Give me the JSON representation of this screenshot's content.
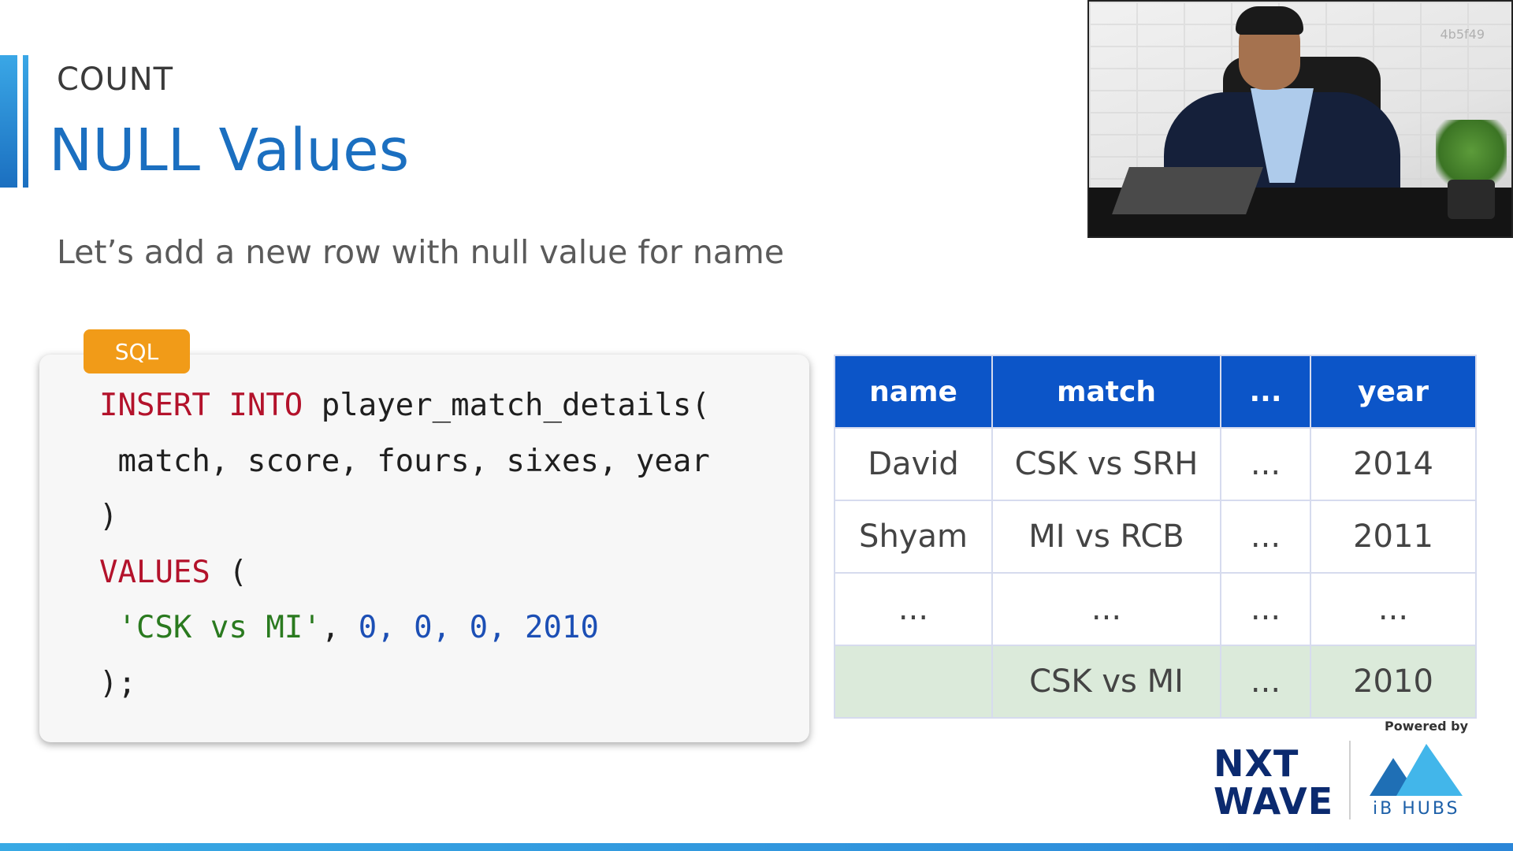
{
  "slide": {
    "topic": "COUNT",
    "title": "NULL Values",
    "subtitle": "Let’s add a new row with null value for name"
  },
  "code_card": {
    "language": "SQL",
    "lines": [
      {
        "parts": [
          {
            "t": "INSERT INTO",
            "c": "kw"
          },
          {
            "t": " player_match_details(",
            "c": ""
          }
        ]
      },
      {
        "parts": [
          {
            "t": " match, score, fours, sixes, year",
            "c": ""
          }
        ]
      },
      {
        "parts": [
          {
            "t": ")",
            "c": ""
          }
        ]
      },
      {
        "parts": [
          {
            "t": "VALUES",
            "c": "kw"
          },
          {
            "t": " (",
            "c": ""
          }
        ]
      },
      {
        "parts": [
          {
            "t": " 'CSK vs MI'",
            "c": "str"
          },
          {
            "t": ", ",
            "c": ""
          },
          {
            "t": "0, 0, 0, 2010",
            "c": "num"
          }
        ]
      },
      {
        "parts": [
          {
            "t": ");",
            "c": ""
          }
        ]
      }
    ]
  },
  "table": {
    "headers": [
      "name",
      "match",
      "...",
      "year"
    ],
    "rows": [
      [
        "David",
        "CSK vs SRH",
        "...",
        "2014"
      ],
      [
        "Shyam",
        "MI vs RCB",
        "...",
        "2011"
      ],
      [
        "...",
        "...",
        "...",
        "..."
      ],
      [
        "",
        "CSK vs MI",
        "...",
        "2010"
      ]
    ]
  },
  "video": {
    "watermark": "4b5f49"
  },
  "branding": {
    "powered_by": "Powered by",
    "nxtwave_line1": "NXT",
    "nxtwave_line2": "WAVE",
    "ibhubs": "iB HUBS"
  },
  "colors": {
    "accent_blue": "#1b6fc0",
    "table_header": "#0c55c8",
    "new_row": "#dbeada",
    "sql_tag": "#f19b18"
  }
}
